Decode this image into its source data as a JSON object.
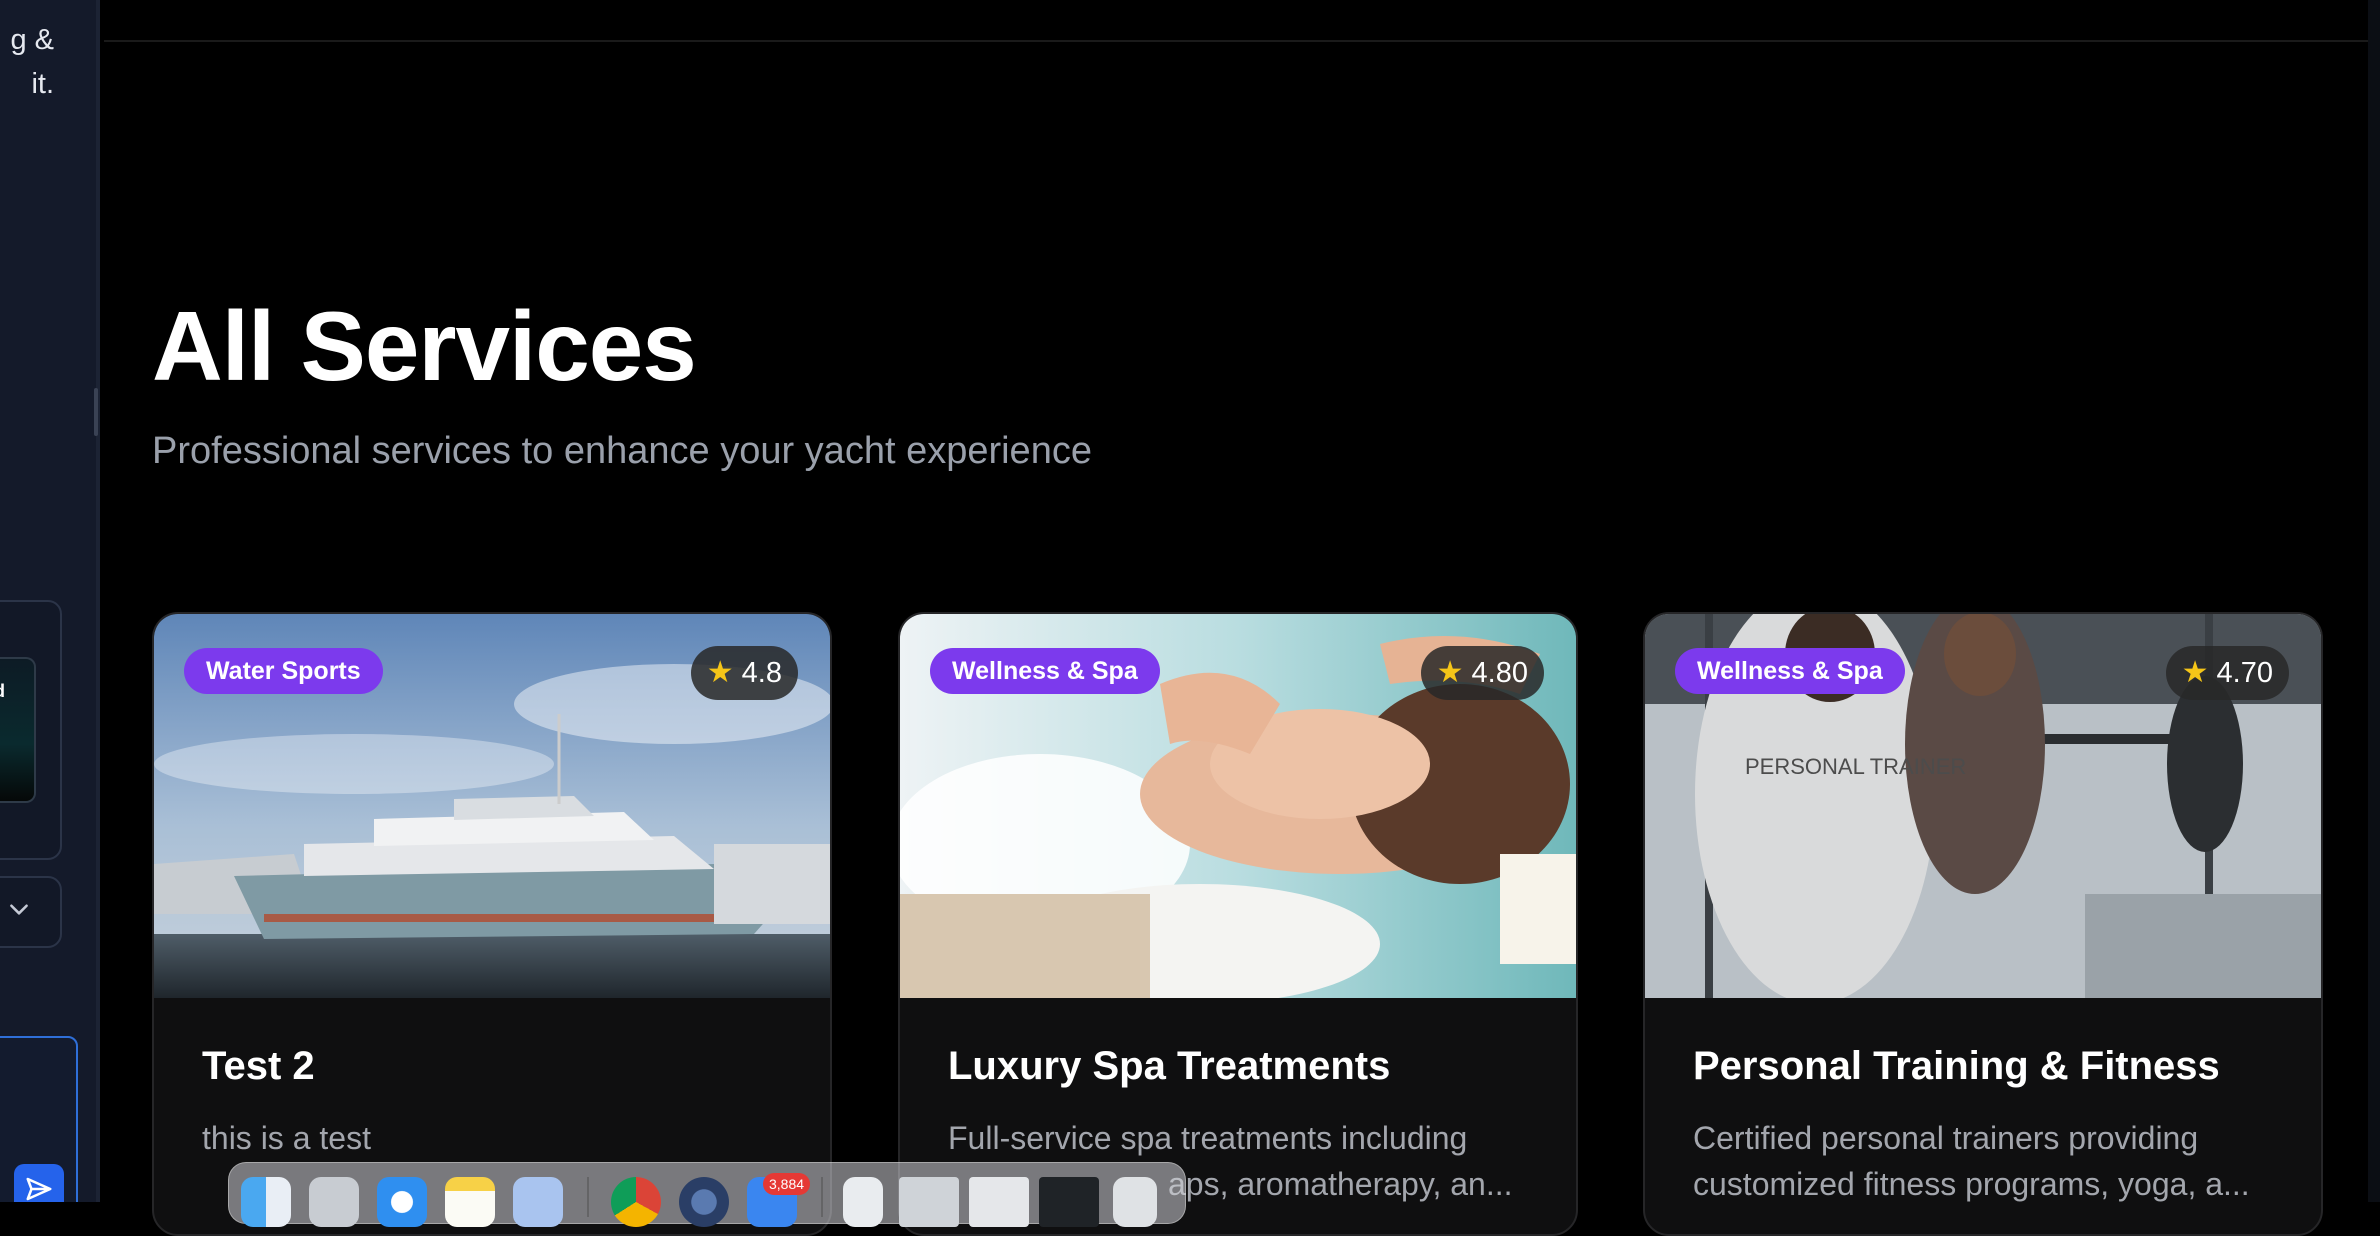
{
  "sidebar": {
    "partial_text_line1": "g &",
    "partial_text_line2": "it.",
    "preview_label": "ed"
  },
  "page": {
    "title": "All Services",
    "subtitle": "Professional services to enhance your yacht experience"
  },
  "services": [
    {
      "category": "Water Sports",
      "rating": "4.8",
      "title": "Test 2",
      "description": "this is a test",
      "image": "yacht-in-marina"
    },
    {
      "category": "Wellness & Spa",
      "rating": "4.80",
      "title": "Luxury Spa Treatments",
      "description_line1": "Full-service spa treatments including",
      "description_line2": "aps, aromatherapy, an...",
      "image": "woman-face-massage"
    },
    {
      "category": "Wellness & Spa",
      "rating": "4.70",
      "title": "Personal Training & Fitness",
      "description_line1": "Certified personal trainers providing",
      "description_line2": "customized fitness programs, yoga, a...",
      "image": "personal-trainer-gym",
      "image_shirt_text": "PERSONAL TRAINER"
    }
  ],
  "dock": {
    "mail_badge": "3,884",
    "icons": [
      "finder-icon",
      "launchpad-icon",
      "safari-icon",
      "notes-icon",
      "preview-icon",
      "chrome-icon",
      "proxyman-icon",
      "mail-icon",
      "documents-icon",
      "window-thumbnail-1",
      "window-thumbnail-2",
      "window-thumbnail-3",
      "window-thumbnail-4",
      "trash-icon"
    ]
  },
  "colors": {
    "category_badge": "#7c3aed",
    "background": "#000000",
    "card": "#0f0f10",
    "accent_blue": "#2563eb"
  }
}
